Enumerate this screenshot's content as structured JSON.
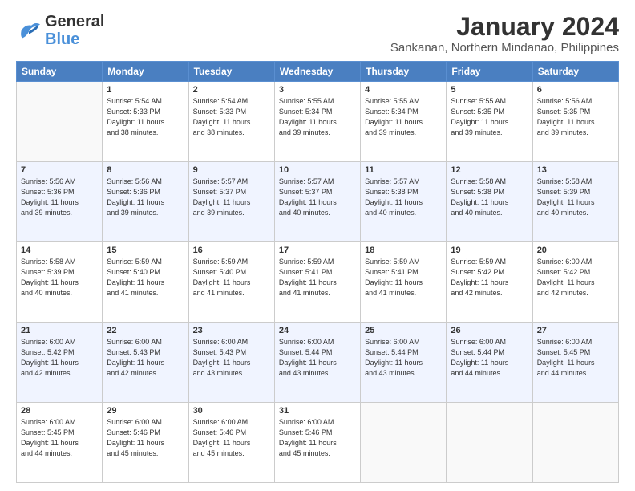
{
  "header": {
    "logo_line1": "General",
    "logo_line2": "Blue",
    "title": "January 2024",
    "location": "Sankanan, Northern Mindanao, Philippines"
  },
  "calendar": {
    "days_of_week": [
      "Sunday",
      "Monday",
      "Tuesday",
      "Wednesday",
      "Thursday",
      "Friday",
      "Saturday"
    ],
    "weeks": [
      [
        {
          "day": "",
          "info": ""
        },
        {
          "day": "1",
          "info": "Sunrise: 5:54 AM\nSunset: 5:33 PM\nDaylight: 11 hours\nand 38 minutes."
        },
        {
          "day": "2",
          "info": "Sunrise: 5:54 AM\nSunset: 5:33 PM\nDaylight: 11 hours\nand 38 minutes."
        },
        {
          "day": "3",
          "info": "Sunrise: 5:55 AM\nSunset: 5:34 PM\nDaylight: 11 hours\nand 39 minutes."
        },
        {
          "day": "4",
          "info": "Sunrise: 5:55 AM\nSunset: 5:34 PM\nDaylight: 11 hours\nand 39 minutes."
        },
        {
          "day": "5",
          "info": "Sunrise: 5:55 AM\nSunset: 5:35 PM\nDaylight: 11 hours\nand 39 minutes."
        },
        {
          "day": "6",
          "info": "Sunrise: 5:56 AM\nSunset: 5:35 PM\nDaylight: 11 hours\nand 39 minutes."
        }
      ],
      [
        {
          "day": "7",
          "info": "Sunrise: 5:56 AM\nSunset: 5:36 PM\nDaylight: 11 hours\nand 39 minutes."
        },
        {
          "day": "8",
          "info": "Sunrise: 5:56 AM\nSunset: 5:36 PM\nDaylight: 11 hours\nand 39 minutes."
        },
        {
          "day": "9",
          "info": "Sunrise: 5:57 AM\nSunset: 5:37 PM\nDaylight: 11 hours\nand 39 minutes."
        },
        {
          "day": "10",
          "info": "Sunrise: 5:57 AM\nSunset: 5:37 PM\nDaylight: 11 hours\nand 40 minutes."
        },
        {
          "day": "11",
          "info": "Sunrise: 5:57 AM\nSunset: 5:38 PM\nDaylight: 11 hours\nand 40 minutes."
        },
        {
          "day": "12",
          "info": "Sunrise: 5:58 AM\nSunset: 5:38 PM\nDaylight: 11 hours\nand 40 minutes."
        },
        {
          "day": "13",
          "info": "Sunrise: 5:58 AM\nSunset: 5:39 PM\nDaylight: 11 hours\nand 40 minutes."
        }
      ],
      [
        {
          "day": "14",
          "info": "Sunrise: 5:58 AM\nSunset: 5:39 PM\nDaylight: 11 hours\nand 40 minutes."
        },
        {
          "day": "15",
          "info": "Sunrise: 5:59 AM\nSunset: 5:40 PM\nDaylight: 11 hours\nand 41 minutes."
        },
        {
          "day": "16",
          "info": "Sunrise: 5:59 AM\nSunset: 5:40 PM\nDaylight: 11 hours\nand 41 minutes."
        },
        {
          "day": "17",
          "info": "Sunrise: 5:59 AM\nSunset: 5:41 PM\nDaylight: 11 hours\nand 41 minutes."
        },
        {
          "day": "18",
          "info": "Sunrise: 5:59 AM\nSunset: 5:41 PM\nDaylight: 11 hours\nand 41 minutes."
        },
        {
          "day": "19",
          "info": "Sunrise: 5:59 AM\nSunset: 5:42 PM\nDaylight: 11 hours\nand 42 minutes."
        },
        {
          "day": "20",
          "info": "Sunrise: 6:00 AM\nSunset: 5:42 PM\nDaylight: 11 hours\nand 42 minutes."
        }
      ],
      [
        {
          "day": "21",
          "info": "Sunrise: 6:00 AM\nSunset: 5:42 PM\nDaylight: 11 hours\nand 42 minutes."
        },
        {
          "day": "22",
          "info": "Sunrise: 6:00 AM\nSunset: 5:43 PM\nDaylight: 11 hours\nand 42 minutes."
        },
        {
          "day": "23",
          "info": "Sunrise: 6:00 AM\nSunset: 5:43 PM\nDaylight: 11 hours\nand 43 minutes."
        },
        {
          "day": "24",
          "info": "Sunrise: 6:00 AM\nSunset: 5:44 PM\nDaylight: 11 hours\nand 43 minutes."
        },
        {
          "day": "25",
          "info": "Sunrise: 6:00 AM\nSunset: 5:44 PM\nDaylight: 11 hours\nand 43 minutes."
        },
        {
          "day": "26",
          "info": "Sunrise: 6:00 AM\nSunset: 5:44 PM\nDaylight: 11 hours\nand 44 minutes."
        },
        {
          "day": "27",
          "info": "Sunrise: 6:00 AM\nSunset: 5:45 PM\nDaylight: 11 hours\nand 44 minutes."
        }
      ],
      [
        {
          "day": "28",
          "info": "Sunrise: 6:00 AM\nSunset: 5:45 PM\nDaylight: 11 hours\nand 44 minutes."
        },
        {
          "day": "29",
          "info": "Sunrise: 6:00 AM\nSunset: 5:46 PM\nDaylight: 11 hours\nand 45 minutes."
        },
        {
          "day": "30",
          "info": "Sunrise: 6:00 AM\nSunset: 5:46 PM\nDaylight: 11 hours\nand 45 minutes."
        },
        {
          "day": "31",
          "info": "Sunrise: 6:00 AM\nSunset: 5:46 PM\nDaylight: 11 hours\nand 45 minutes."
        },
        {
          "day": "",
          "info": ""
        },
        {
          "day": "",
          "info": ""
        },
        {
          "day": "",
          "info": ""
        }
      ]
    ]
  }
}
